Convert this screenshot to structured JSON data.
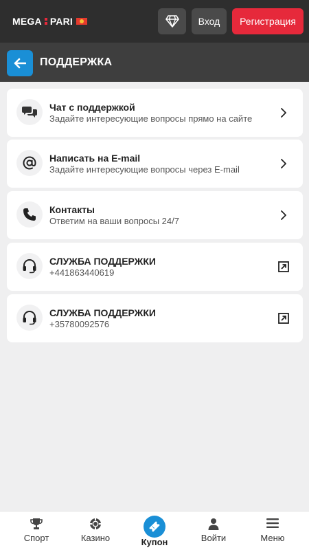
{
  "header": {
    "logo_left": "MEGA",
    "logo_right": "PARI",
    "login_label": "Вход",
    "register_label": "Регистрация"
  },
  "page": {
    "title": "ПОДДЕРЖКА"
  },
  "support_items": [
    {
      "title": "Чат с поддержкой",
      "subtitle": "Задайте интересующие вопросы прямо на сайте",
      "icon": "chat-icon",
      "action_icon": "chevron-right-icon"
    },
    {
      "title": "Написать на E-mail",
      "subtitle": "Задайте интересующие вопросы через E-mail",
      "icon": "at-icon",
      "action_icon": "chevron-right-icon"
    },
    {
      "title": "Контакты",
      "subtitle": "Ответим на ваши вопросы 24/7",
      "icon": "phone-icon",
      "action_icon": "chevron-right-icon"
    },
    {
      "title": "СЛУЖБА ПОДДЕРЖКИ",
      "subtitle": "+441863440619",
      "icon": "headset-icon",
      "action_icon": "external-link-icon"
    },
    {
      "title": "СЛУЖБА ПОДДЕРЖКИ",
      "subtitle": "+35780092576",
      "icon": "headset-icon",
      "action_icon": "external-link-icon"
    }
  ],
  "bottom_nav": [
    {
      "label": "Спорт",
      "icon": "trophy-icon"
    },
    {
      "label": "Казино",
      "icon": "casino-chip-icon"
    },
    {
      "label": "Купон",
      "icon": "ticket-icon"
    },
    {
      "label": "Войти",
      "icon": "user-icon"
    },
    {
      "label": "Меню",
      "icon": "menu-icon"
    }
  ],
  "colors": {
    "brand_red": "#e6293b",
    "accent_blue": "#1a8fd6",
    "header_bg": "#2e2e2e",
    "subheader_bg": "#3e3e3e",
    "page_bg": "#efeff0"
  }
}
